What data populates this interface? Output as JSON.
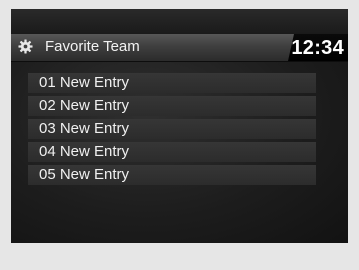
{
  "header": {
    "icon": "gear-icon",
    "title": "Favorite Team",
    "clock": "12:34"
  },
  "list": {
    "items": [
      {
        "label": "01 New Entry"
      },
      {
        "label": "02 New Entry"
      },
      {
        "label": "03 New Entry"
      },
      {
        "label": "04 New Entry"
      },
      {
        "label": "05 New Entry"
      }
    ]
  }
}
